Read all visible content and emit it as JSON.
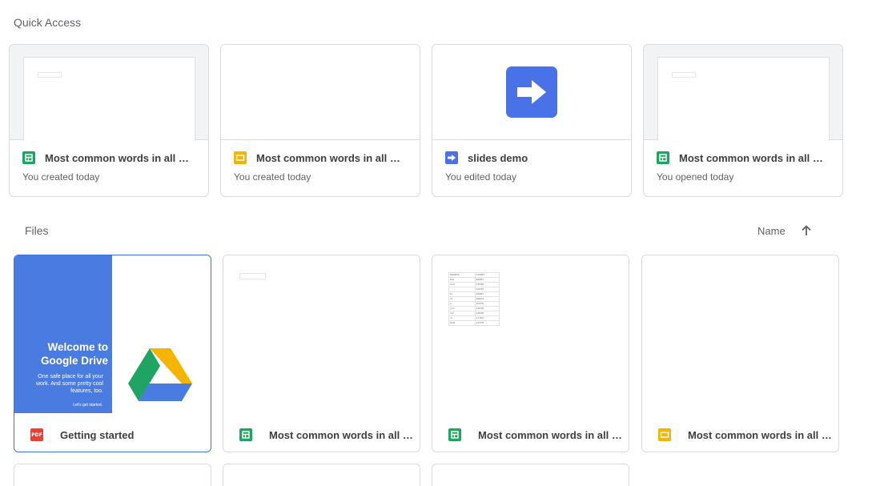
{
  "quick_access": {
    "title": "Quick Access",
    "cards": [
      {
        "name": "Most common words in all of ...",
        "subtitle": "You created today",
        "type_icon": "sheets-icon"
      },
      {
        "name": "Most common words in all of ...",
        "subtitle": "You created today",
        "type_icon": "slides-icon"
      },
      {
        "name": "slides demo",
        "subtitle": "You edited today",
        "type_icon": "slides-arrow-icon"
      },
      {
        "name": "Most common words in all of ...",
        "subtitle": "You opened today",
        "type_icon": "sheets-icon"
      }
    ]
  },
  "files": {
    "title": "Files",
    "sort": {
      "label": "Name",
      "direction_icon": "arrow-up-icon"
    },
    "items": [
      {
        "name": "Getting started",
        "type_icon": "pdf-icon",
        "pdf_badge": "PDF",
        "thumb": {
          "heading": "Welcome to Google Drive",
          "body": "One safe place for all your work. And some pretty cool features, too.",
          "footer": "Let's get started."
        }
      },
      {
        "name": "Most common words in all o...",
        "type_icon": "sheets-icon"
      },
      {
        "name": "Most common words in all o...",
        "type_icon": "sheets-icon",
        "thumb_table": {
          "headers": [
            "WORDS",
            "COUNT"
          ],
          "rows": [
            [
              "the",
              "26981"
            ],
            [
              "and",
              "27639"
            ],
            [
              "",
              "21539"
            ],
            [
              "to",
              "20987"
            ],
            [
              "of",
              "19914"
            ],
            [
              "a",
              "15375"
            ],
            [
              "you",
              "14618"
            ],
            [
              "my",
              "13638"
            ],
            [
              "in",
              "11702"
            ],
            [
              "that",
              "11370"
            ]
          ]
        }
      },
      {
        "name": "Most common words in all o...",
        "type_icon": "slides-icon"
      }
    ]
  },
  "colors": {
    "sheets": "#1fa463",
    "slides": "#f4b400",
    "slides_blue": "#4a72e8",
    "pdf": "#e94235",
    "selected_border": "#3f6fd8"
  }
}
